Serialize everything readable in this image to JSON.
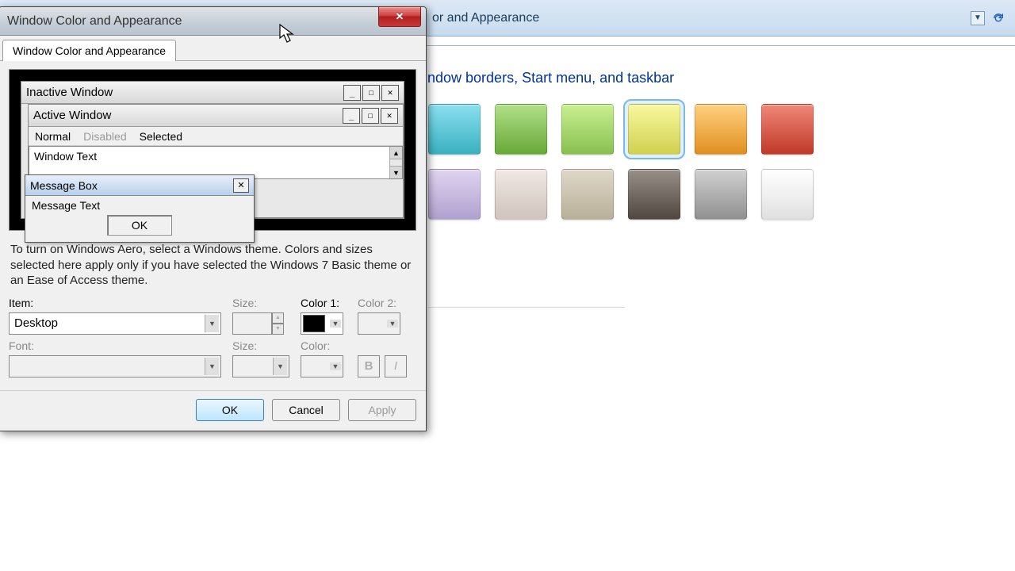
{
  "bg": {
    "title_fragment": "or and Appearance",
    "heading": "indow borders, Start menu, and taskbar"
  },
  "swatches": {
    "row1": [
      "#5ac8d8",
      "#8cc868",
      "#a8e070",
      "#e8e878",
      "#f0b050",
      "#e06050"
    ],
    "row2": [
      "#c8b8e0",
      "#e0d8d0",
      "#c8c0b0",
      "#706860",
      "#b0b0b0",
      "#f0f0f0"
    ],
    "selected_index": 3
  },
  "dialog": {
    "title": "Window Color and Appearance",
    "tab": "Window Color and Appearance",
    "preview": {
      "inactive_title": "Inactive Window",
      "active_title": "Active Window",
      "menu_normal": "Normal",
      "menu_disabled": "Disabled",
      "menu_selected": "Selected",
      "window_text": "Window Text",
      "msgbox_title": "Message Box",
      "msgbox_text": "Message Text",
      "msgbox_ok": "OK"
    },
    "description": "To turn on Windows Aero, select a Windows theme.  Colors and sizes selected here apply only if you have selected the Windows 7 Basic theme or an Ease of Access theme.",
    "labels": {
      "item": "Item:",
      "size": "Size:",
      "color1": "Color 1:",
      "color2": "Color 2:",
      "font": "Font:",
      "color": "Color:",
      "bold": "B",
      "italic": "I"
    },
    "item_value": "Desktop",
    "buttons": {
      "ok": "OK",
      "cancel": "Cancel",
      "apply": "Apply"
    }
  }
}
